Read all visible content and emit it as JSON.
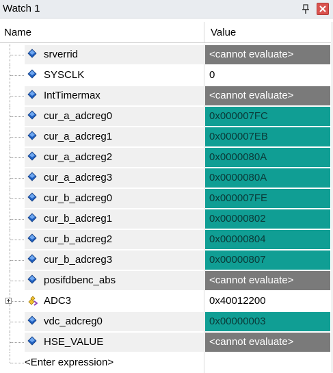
{
  "window": {
    "title": "Watch 1",
    "pin_icon": "pin-icon",
    "close_icon": "close-icon"
  },
  "colors": {
    "gray_value": "#7a7a7a",
    "teal_value": "#109e94",
    "icon_blue": "#1f5fbf"
  },
  "header": {
    "name": "Name",
    "value": "Value"
  },
  "rows": [
    {
      "name": "srverrid",
      "value": "<cannot evaluate>",
      "style": "gray",
      "icon": "variable-diamond-icon"
    },
    {
      "name": "SYSCLK",
      "value": "0",
      "style": "white",
      "icon": "variable-diamond-icon"
    },
    {
      "name": "IntTimermax",
      "value": "<cannot evaluate>",
      "style": "gray",
      "icon": "variable-diamond-icon"
    },
    {
      "name": "cur_a_adcreg0",
      "value": "0x000007FC",
      "style": "teal",
      "icon": "variable-diamond-icon"
    },
    {
      "name": "cur_a_adcreg1",
      "value": "0x000007EB",
      "style": "teal",
      "icon": "variable-diamond-icon"
    },
    {
      "name": "cur_a_adcreg2",
      "value": "0x0000080A",
      "style": "teal",
      "icon": "variable-diamond-icon"
    },
    {
      "name": "cur_a_adcreg3",
      "value": "0x0000080A",
      "style": "teal",
      "icon": "variable-diamond-icon"
    },
    {
      "name": "cur_b_adcreg0",
      "value": "0x000007FE",
      "style": "teal",
      "icon": "variable-diamond-icon"
    },
    {
      "name": "cur_b_adcreg1",
      "value": "0x00000802",
      "style": "teal",
      "icon": "variable-diamond-icon"
    },
    {
      "name": "cur_b_adcreg2",
      "value": "0x00000804",
      "style": "teal",
      "icon": "variable-diamond-icon"
    },
    {
      "name": "cur_b_adcreg3",
      "value": "0x00000807",
      "style": "teal",
      "icon": "variable-diamond-icon"
    },
    {
      "name": "posifdbenc_abs",
      "value": "<cannot evaluate>",
      "style": "gray",
      "icon": "variable-diamond-icon"
    },
    {
      "name": "ADC3",
      "value": "0x40012200",
      "style": "white",
      "icon": "struct-icon",
      "expandable": true
    },
    {
      "name": "vdc_adcreg0",
      "value": "0x00000003",
      "style": "teal",
      "icon": "variable-diamond-icon"
    },
    {
      "name": "HSE_VALUE",
      "value": "<cannot evaluate>",
      "style": "gray",
      "icon": "variable-diamond-icon"
    }
  ],
  "enter_expression": "<Enter expression>"
}
